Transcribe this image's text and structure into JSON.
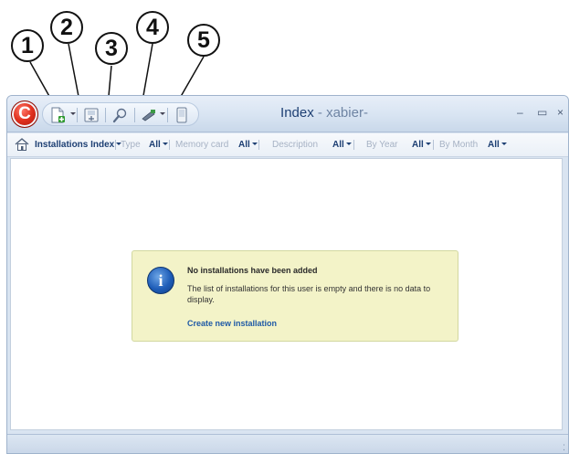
{
  "callouts": [
    "1",
    "2",
    "3",
    "4",
    "5"
  ],
  "window": {
    "app_letter": "C",
    "title": "Index",
    "title_separator": "-",
    "user": "xabier-",
    "minimize_glyph": "–",
    "maximize_glyph": "▭",
    "close_glyph": "×"
  },
  "quick_access": {
    "icons": [
      "new-document-icon",
      "export-icon",
      "search-icon",
      "tool-icon",
      "device-icon"
    ]
  },
  "toolbar": {
    "index_label": "Installations Index",
    "type_label": "Type",
    "type_value": "All",
    "memory_label": "Memory card",
    "memory_value": "All",
    "description_label": "Description",
    "description_value": "All",
    "year_label": "By Year",
    "year_value": "All",
    "month_label": "By Month",
    "month_value": "All"
  },
  "info": {
    "icon_letter": "i",
    "title": "No installations have been added",
    "body": "The list of installations for this user is empty and there is no data to display.",
    "link": "Create new installation"
  },
  "status": {
    "grip": "⁚"
  }
}
